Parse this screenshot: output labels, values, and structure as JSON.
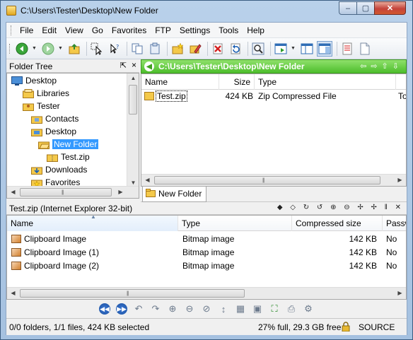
{
  "window": {
    "title": "C:\\Users\\Tester\\Desktop\\New Folder",
    "min_glyph": "–",
    "max_glyph": "▢",
    "close_glyph": "✕"
  },
  "menu": [
    "File",
    "Edit",
    "View",
    "Go",
    "Favorites",
    "FTP",
    "Settings",
    "Tools",
    "Help"
  ],
  "folder_tree": {
    "title": "Folder Tree",
    "pin_glyph": "⇱",
    "close_glyph": "×",
    "items": [
      {
        "label": "Desktop"
      },
      {
        "label": "Libraries"
      },
      {
        "label": "Tester"
      },
      {
        "label": "Contacts"
      },
      {
        "label": "Desktop"
      },
      {
        "label": "New Folder"
      },
      {
        "label": "Test.zip"
      },
      {
        "label": "Downloads"
      },
      {
        "label": "Favorites"
      }
    ]
  },
  "path_bar": {
    "path": "C:\\Users\\Tester\\Desktop\\New Folder",
    "nav_glyphs": "⇦⇨⇧⇩"
  },
  "file_list": {
    "columns": [
      "Name",
      "Size",
      "Type"
    ],
    "rows": [
      {
        "name": "Test.zip",
        "size": "424 KB",
        "type": "Zip Compressed File",
        "extra": "Too"
      }
    ]
  },
  "tab": {
    "label": "New Folder"
  },
  "archive": {
    "title": "Test.zip (Internet Explorer 32-bit)",
    "tool_glyphs": "◆ ◇ ↻ ↺ ⊕ ⊖ ✢ ✢ ‖ ✕",
    "columns": [
      "Name",
      "Type",
      "Compressed size",
      "Passw"
    ],
    "rows": [
      {
        "name": "Clipboard Image",
        "type": "Bitmap image",
        "size": "142 KB",
        "password": "No"
      },
      {
        "name": "Clipboard Image (1)",
        "type": "Bitmap image",
        "size": "142 KB",
        "password": "No"
      },
      {
        "name": "Clipboard Image (2)",
        "type": "Bitmap image",
        "size": "142 KB",
        "password": "No"
      }
    ]
  },
  "status": {
    "left": "0/0 folders, 1/1 files, 424 KB selected",
    "disk": "27% full, 29.3 GB free",
    "source": "SOURCE"
  },
  "colors": {
    "path_bar": "#4dbe2c",
    "selection": "#3399ff"
  }
}
